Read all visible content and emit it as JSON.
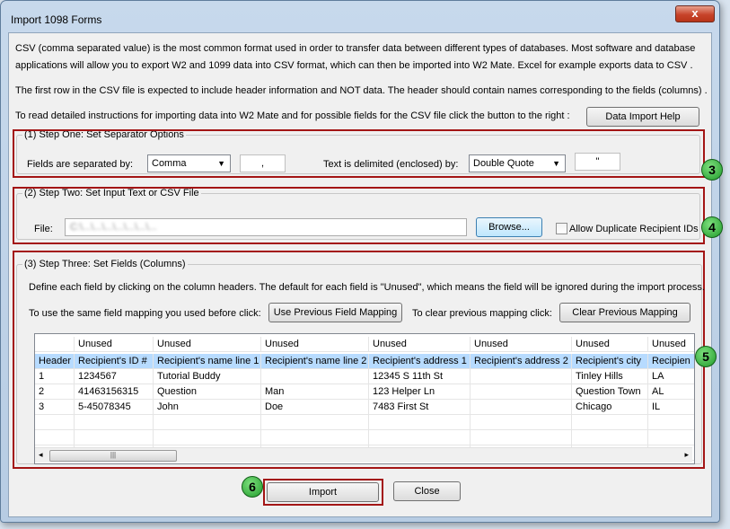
{
  "window": {
    "title": "Import 1098 Forms",
    "close": "x"
  },
  "intro": {
    "line1": "CSV (comma separated value) is the most common format used in order to transfer data between different types of databases.  Most software and database",
    "line2": "applications will allow you to export W2 and 1099 data into CSV format, which can then be imported into W2 Mate. Excel for example exports data to CSV .",
    "line3": "The first row in the CSV file is expected to include header information and NOT data. The header should contain names corresponding to the fields (columns) .",
    "line4": "To read detailed instructions for importing data into W2 Mate and for possible fields for the CSV file click the button to the right :",
    "help_button": "Data Import Help"
  },
  "step1": {
    "legend": "(1)  Step One: Set Separator Options",
    "separated_label": "Fields are separated by:",
    "separator_value": "Comma",
    "separator_char": ",",
    "delimited_label": "Text is delimited (enclosed) by:",
    "delimiter_value": "Double Quote",
    "delimiter_char": "\""
  },
  "step2": {
    "legend": "(2)  Step Two: Set Input Text or CSV File",
    "file_label": "File:",
    "file_value": "C:\\...\\...\\...\\...\\...\\...\\...",
    "browse": "Browse...",
    "allow_dup": "Allow Duplicate Recipient IDs"
  },
  "step3": {
    "legend": "(3)  Step Three: Set Fields (Columns)",
    "desc": "Define each field by clicking on the column headers. The default for each field is \"Unused\", which means the field will be ignored during the import process.",
    "same_label": "To use the same field mapping you used before click:",
    "prev_button": "Use Previous Field Mapping",
    "clear_label": "To clear previous mapping click:",
    "clear_button": "Clear Previous Mapping"
  },
  "grid": {
    "mapping": [
      "",
      "Unused",
      "Unused",
      "Unused",
      "Unused",
      "Unused",
      "Unused",
      "Unused"
    ],
    "header": [
      "Header",
      "Recipient's ID #",
      "Recipient's name line 1",
      "Recipient's name line 2",
      "Recipient's address 1",
      "Recipient's address 2",
      "Recipient's city",
      "Recipien"
    ],
    "rows": [
      [
        "1",
        "1234567",
        "Tutorial Buddy",
        "",
        "12345 S 11th St",
        "",
        "Tinley Hills",
        "LA"
      ],
      [
        "2",
        "41463156315",
        "Question",
        "Man",
        "123 Helper Ln",
        "",
        "Question Town",
        "AL"
      ],
      [
        "3",
        "5-45078345",
        "John",
        "Doe",
        "7483 First St",
        "",
        "Chicago",
        "IL"
      ]
    ]
  },
  "footer": {
    "import": "Import",
    "close": "Close"
  },
  "badges": {
    "b3": "3",
    "b4": "4",
    "b5": "5",
    "b6": "6"
  },
  "colors": {
    "highlight_box": "#a31515",
    "badge": "#2fae3a",
    "header_row": "#b7dbff"
  }
}
